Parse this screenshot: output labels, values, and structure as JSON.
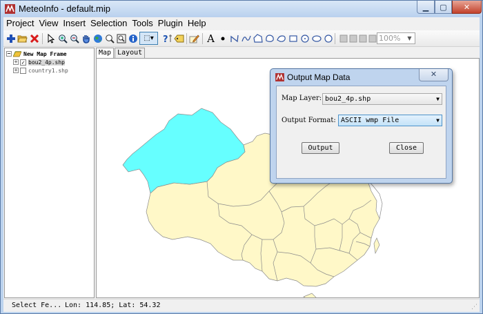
{
  "window": {
    "title": "MeteoInfo - default.mip",
    "app_icon": "meteoinfo-icon",
    "minimize_glyph": "▁",
    "maximize_glyph": "▢",
    "close_glyph": "✕"
  },
  "menu": [
    "Project",
    "View",
    "Insert",
    "Selection",
    "Tools",
    "Plugin",
    "Help"
  ],
  "toolbar": {
    "buttons": [
      "add-layer-icon",
      "open-folder-icon",
      "remove-layer-icon",
      "select-arrow-icon",
      "zoom-in-icon",
      "zoom-out-icon",
      "pan-hand-icon",
      "full-extent-globe-icon",
      "zoom-magnifier-icon",
      "zoom-layer-icon",
      "identify-info-icon",
      "select-features-icon",
      "measure-help-icon",
      "label-icon",
      "edit-pencil-icon",
      "text-tool-icon",
      "point-tool-icon",
      "polyline-tool-icon",
      "freehand-curve-icon",
      "polygon-tool-icon",
      "curve-polygon-icon",
      "rectangle-tool-icon",
      "circle-tool-icon",
      "ellipse-tool-icon",
      "layout-portrait-icon",
      "layout-landscape-icon",
      "page-setup-icon",
      "fit-page-icon"
    ],
    "zoom_value": "100%",
    "select_tool_glyph": "⬚▾"
  },
  "legend": {
    "frame_label": "New Map Frame",
    "layers": [
      {
        "label": "bou2_4p.shp",
        "checked": true,
        "selected": true
      },
      {
        "label": "country1.shp",
        "checked": false,
        "selected": false
      }
    ]
  },
  "tabs": [
    {
      "label": "Map",
      "active": true
    },
    {
      "label": "Layout",
      "active": false
    }
  ],
  "map": {
    "highlight_color": "#66ffff",
    "land_color": "#fff8c8",
    "border_color": "#8a8a8a"
  },
  "status": {
    "tool": "Select Fe...",
    "coords": "Lon: 114.85; Lat: 54.32"
  },
  "dialog": {
    "title": "Output Map Data",
    "map_layer_label": "Map Layer:",
    "map_layer_value": "bou2_4p.shp",
    "format_label": "Output Format:",
    "format_value": "ASCII wmp File",
    "output_button": "Output",
    "close_button": "Close",
    "close_glyph": "✕"
  }
}
